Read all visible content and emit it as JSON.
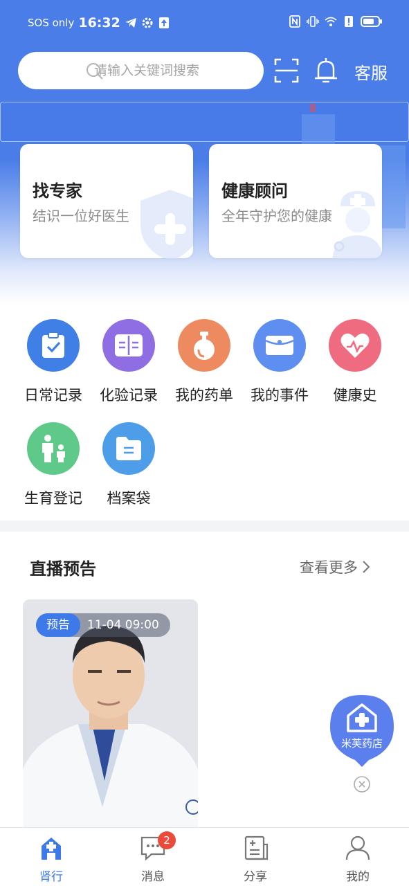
{
  "status_bar": {
    "carrier": "SOS only",
    "time": "16:32",
    "icons": [
      "telegram-icon",
      "gear-icon",
      "upload-icon",
      "nfc-icon",
      "vibrate-icon",
      "wifi-icon",
      "alert-icon",
      "battery-icon"
    ]
  },
  "header": {
    "search_placeholder": "请输入关键词搜索",
    "scan_icon": "scan-icon",
    "bell_icon": "bell-icon",
    "service_label": "客服"
  },
  "cards": [
    {
      "title": "找专家",
      "subtitle": "结识一位好医生",
      "icon": "shield-plus-icon"
    },
    {
      "title": "健康顾问",
      "subtitle": "全年守护您的健康",
      "icon": "nurse-icon"
    }
  ],
  "shortcuts": [
    {
      "label": "日常记录",
      "icon": "clipboard-check-icon",
      "color": "#3f7fe6"
    },
    {
      "label": "化验记录",
      "icon": "book-icon",
      "color": "#8f6de3"
    },
    {
      "label": "我的药单",
      "icon": "medicine-bottle-icon",
      "color": "#ee8a5f"
    },
    {
      "label": "我的事件",
      "icon": "envelope-icon",
      "color": "#5e8ff0"
    },
    {
      "label": "健康史",
      "icon": "heart-pulse-icon",
      "color": "#ef6b7f"
    },
    {
      "label": "生育登记",
      "icon": "parent-child-icon",
      "color": "#5fc98a"
    },
    {
      "label": "档案袋",
      "icon": "folder-icon",
      "color": "#4d9de8"
    }
  ],
  "live": {
    "section_title": "直播预告",
    "more_label": "查看更多",
    "card": {
      "tag": "预告",
      "datetime": "11-04 09:00"
    }
  },
  "fab": {
    "label": "米芙药店",
    "icon": "pharmacy-house-icon"
  },
  "tabbar": {
    "items": [
      {
        "label": "肾行",
        "icon": "home-icon",
        "active": true
      },
      {
        "label": "消息",
        "icon": "message-icon",
        "badge": "2"
      },
      {
        "label": "分享",
        "icon": "share-doc-icon"
      },
      {
        "label": "我的",
        "icon": "user-icon"
      }
    ]
  },
  "colors": {
    "primary": "#4a7de8",
    "accent": "#3d79e8",
    "badge": "#e94b3c"
  }
}
